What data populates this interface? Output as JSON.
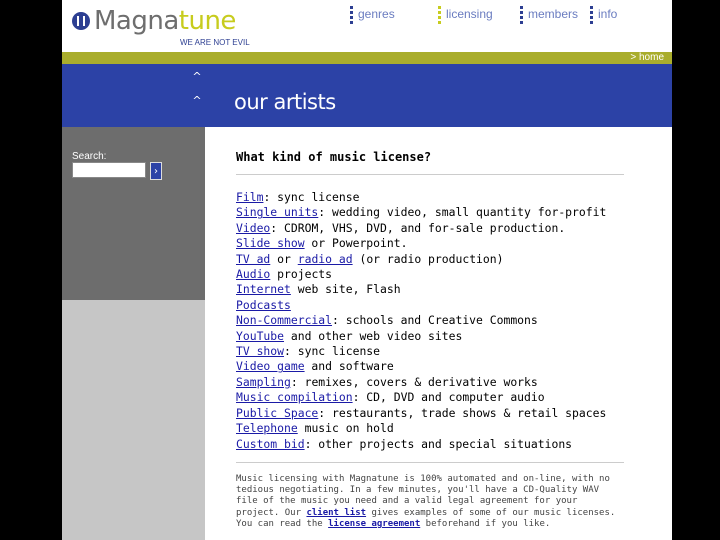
{
  "logo": {
    "text_main": "Magna",
    "text_accent": "tune",
    "tagline": "WE ARE NOT EVIL"
  },
  "nav": [
    {
      "label": "genres"
    },
    {
      "label": "licensing"
    },
    {
      "label": "members"
    },
    {
      "label": "info"
    }
  ],
  "olive_bar": {
    "home_label": "home"
  },
  "band": {
    "title": "our artists",
    "caret": "^"
  },
  "sidebar": {
    "search_label": "Search:",
    "search_value": "",
    "go_glyph": "›"
  },
  "main": {
    "question": "What kind of music license?",
    "licenses": [
      {
        "links": [
          "Film"
        ],
        "parts": [
          ": sync license"
        ]
      },
      {
        "links": [
          "Single units"
        ],
        "parts": [
          ": wedding video, small quantity for-profit"
        ]
      },
      {
        "links": [
          "Video"
        ],
        "parts": [
          ": CDROM, VHS, DVD, and for-sale production."
        ]
      },
      {
        "links": [
          "Slide show"
        ],
        "parts": [
          " or Powerpoint."
        ]
      },
      {
        "links": [
          "TV ad",
          "radio ad"
        ],
        "parts": [
          " or ",
          " (or radio production)"
        ]
      },
      {
        "links": [
          "Audio"
        ],
        "parts": [
          " projects"
        ]
      },
      {
        "links": [
          "Internet"
        ],
        "parts": [
          " web site, Flash"
        ]
      },
      {
        "links": [
          "Podcasts"
        ],
        "parts": [
          ""
        ]
      },
      {
        "links": [
          "Non-Commercial"
        ],
        "parts": [
          ": schools and Creative Commons"
        ]
      },
      {
        "links": [
          "YouTube"
        ],
        "parts": [
          " and other web video sites"
        ]
      },
      {
        "links": [
          "TV show"
        ],
        "parts": [
          ": sync license"
        ]
      },
      {
        "links": [
          "Video game"
        ],
        "parts": [
          " and software"
        ]
      },
      {
        "links": [
          "Sampling"
        ],
        "parts": [
          ": remixes, covers & derivative works"
        ]
      },
      {
        "links": [
          "Music compilation"
        ],
        "parts": [
          ": CD, DVD and computer audio"
        ]
      },
      {
        "links": [
          "Public Space"
        ],
        "parts": [
          ": restaurants, trade shows & retail spaces"
        ]
      },
      {
        "links": [
          "Telephone"
        ],
        "parts": [
          " music on hold"
        ]
      },
      {
        "links": [
          "Custom bid"
        ],
        "parts": [
          ": other projects and special situations"
        ]
      }
    ],
    "footer": {
      "text_1": "Music licensing with Magnatune is 100% automated and on-line, with no tedious negotiating. In a few minutes, you'll have a CD-Quality WAV file of the music you need and a valid legal agreement for your project. Our ",
      "link_1": "client list",
      "text_2": " gives examples of some of our music licenses. You can read the ",
      "link_2": "license agreement",
      "text_3": " beforehand if you like."
    }
  }
}
